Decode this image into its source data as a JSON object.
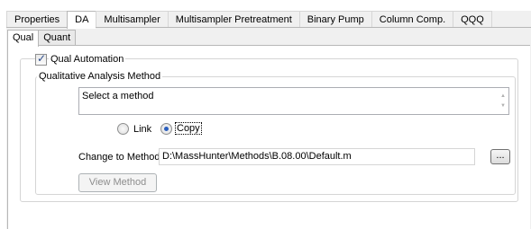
{
  "top_tabs": [
    "Properties",
    "DA",
    "Multisampler",
    "Multisampler Pretreatment",
    "Binary Pump",
    "Column Comp.",
    "QQQ"
  ],
  "active_top_tab": "DA",
  "sub_tabs": [
    "Qual",
    "Quant"
  ],
  "active_sub_tab": "Qual",
  "qual_automation": {
    "label": "Qual Automation",
    "checked": true
  },
  "method_group": {
    "title": "Qualitative Analysis Method",
    "method_text": "Select a method",
    "radio_link": "Link",
    "radio_copy": "Copy",
    "selected_option": "Copy",
    "change_label": "Change to Method:",
    "change_path": "D:\\MassHunter\\Methods\\B.08.00\\Default.m",
    "browse_label": "...",
    "view_button": "View Method"
  }
}
